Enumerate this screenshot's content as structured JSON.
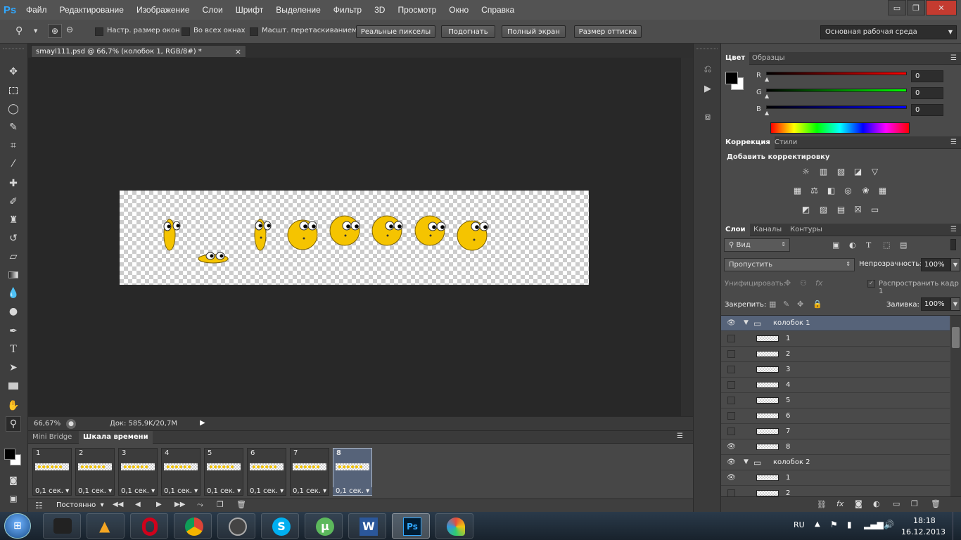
{
  "app": {
    "logo": "Ps"
  },
  "menu": [
    "Файл",
    "Редактирование",
    "Изображение",
    "Слои",
    "Шрифт",
    "Выделение",
    "Фильтр",
    "3D",
    "Просмотр",
    "Окно",
    "Справка"
  ],
  "window": {
    "minimize": "▭",
    "restore": "❐",
    "close": "✕"
  },
  "options": {
    "resize_windows": "Настр. размер окон",
    "all_windows": "Во всех окнах",
    "scrubby_zoom": "Масшт. перетаскиванием",
    "actual_pixels": "Реальные пикселы",
    "fit_screen": "Подогнать",
    "fill_screen": "Полный экран",
    "print_size": "Размер оттиска",
    "workspace": "Основная рабочая среда"
  },
  "document": {
    "tab_title": "smayl111.psd @ 66,7% (колобок 1, RGB/8#) *",
    "close": "×"
  },
  "status": {
    "zoom": "66,67%",
    "doc": "Док: 585,9K/20,7M"
  },
  "timeline": {
    "tabs": [
      "Mini Bridge",
      "Шкала времени"
    ],
    "frames": [
      {
        "num": "1",
        "delay": "0,1 сек."
      },
      {
        "num": "2",
        "delay": "0,1 сек."
      },
      {
        "num": "3",
        "delay": "0,1 сек."
      },
      {
        "num": "4",
        "delay": "0,1 сек."
      },
      {
        "num": "5",
        "delay": "0,1 сек."
      },
      {
        "num": "6",
        "delay": "0,1 сек."
      },
      {
        "num": "7",
        "delay": "0,1 сек."
      },
      {
        "num": "8",
        "delay": "0,1 сек."
      }
    ],
    "loop": "Постоянно"
  },
  "color_panel": {
    "tabs": [
      "Цвет",
      "Образцы"
    ],
    "channels": [
      {
        "label": "R",
        "value": "0",
        "color": "#ff0000"
      },
      {
        "label": "G",
        "value": "0",
        "color": "#00ff00"
      },
      {
        "label": "B",
        "value": "0",
        "color": "#0000ff"
      }
    ]
  },
  "adjust_panel": {
    "tabs": [
      "Коррекция",
      "Стили"
    ],
    "title": "Добавить корректировку"
  },
  "layers_panel": {
    "tabs": [
      "Слои",
      "Каналы",
      "Контуры"
    ],
    "filter": "Вид",
    "blend": "Пропустить",
    "opacity_label": "Непрозрачность:",
    "opacity": "100%",
    "unify_label": "Унифицировать:",
    "propagate": "Распространить кадр 1",
    "lock_label": "Закрепить:",
    "fill_label": "Заливка:",
    "fill": "100%",
    "layers": [
      {
        "name": "колобок 1",
        "group": true,
        "visible": true,
        "selected": true
      },
      {
        "name": "1",
        "group": false,
        "visible": false
      },
      {
        "name": "2",
        "group": false,
        "visible": false
      },
      {
        "name": "3",
        "group": false,
        "visible": false
      },
      {
        "name": "4",
        "group": false,
        "visible": false
      },
      {
        "name": "5",
        "group": false,
        "visible": false
      },
      {
        "name": "6",
        "group": false,
        "visible": false
      },
      {
        "name": "7",
        "group": false,
        "visible": false
      },
      {
        "name": "8",
        "group": false,
        "visible": true
      },
      {
        "name": "колобок 2",
        "group": true,
        "visible": true
      },
      {
        "name": "1",
        "group": false,
        "visible": true
      },
      {
        "name": "2",
        "group": false,
        "visible": false
      }
    ]
  },
  "taskbar": {
    "lang": "RU",
    "time": "18:18",
    "date": "16.12.2013"
  }
}
